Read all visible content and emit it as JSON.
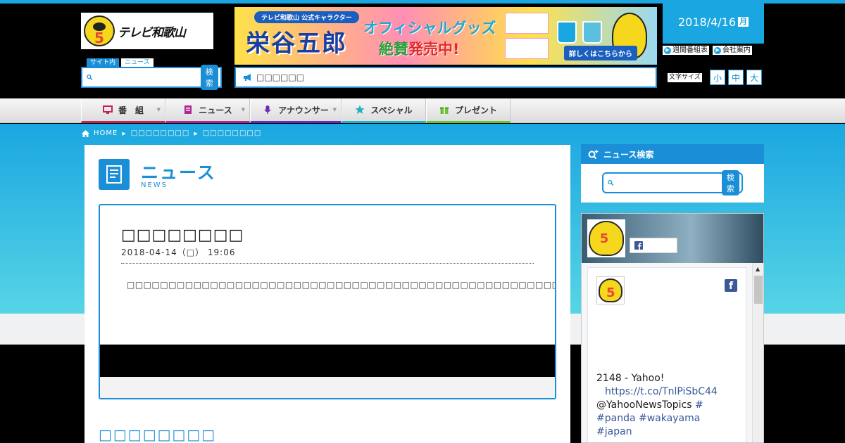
{
  "header": {
    "logo_text": "テレビ和歌山",
    "search_tabs": [
      "サイト内",
      "ニュース"
    ],
    "search_button": "検索",
    "search_placeholder": "",
    "ticker_text": "□□□□□□",
    "date": "2018/4/16",
    "day_of_week": "月",
    "mini_links": [
      "週間番組表",
      "会社案内"
    ],
    "font_size_label": "文字サイズ",
    "font_size_options": [
      "小",
      "中",
      "大"
    ]
  },
  "banner": {
    "top_label": "テレビ和歌山 公式キャラクター",
    "name": "栄谷五郎",
    "goods": "オフィシャルグッズ",
    "sale_part1": "絶賛",
    "sale_part2": "発売中!",
    "link": "詳しくはこちらから"
  },
  "nav": {
    "items": [
      {
        "label": "番　組",
        "icon": "tv-icon",
        "color": "#c7215d",
        "dropdown": true
      },
      {
        "label": "ニュース",
        "icon": "newspaper-icon",
        "color": "#b0278f",
        "dropdown": true
      },
      {
        "label": "アナウンサー",
        "icon": "microphone-icon",
        "color": "#6b2bb5",
        "dropdown": true
      },
      {
        "label": "スペシャル",
        "icon": "star-icon",
        "color": "#1fb3c4",
        "dropdown": false
      },
      {
        "label": "プレゼント",
        "icon": "gift-icon",
        "color": "#6fc13b",
        "dropdown": false
      }
    ]
  },
  "breadcrumb": {
    "home": "HOME",
    "items": [
      "□□□□□□□□",
      "□□□□□□□□"
    ]
  },
  "news_section": {
    "title": "ニュース",
    "subtitle": "NEWS"
  },
  "article": {
    "heading": "□□□□□□□□",
    "date": "2018-04-14（□） 19:06",
    "body": "□□□□□□□□□□□□□□□□□□□□□□□□□□□□□□□□□□□□□□□□□□□□□□□□□□□□□□□□□□□□□□□□□□□□□□□□□□□□□□□□□□□□□□□□□□□□□□□□□□□□□□□□□□□□□□□□□□□□□□□□□□□□□□□□□□□□□□□□□□□□□□□□□□□□□□□□□□□□□□□□□□□□□□□□□□□□□□□□□□□□□□□□□□□□□□□□□□□□□□□□□□□□□□□□□□□□□□□□□□□□□□□□□□□□□□□□□□□□□□□□□□□□□□□□□□□□□"
  },
  "related": {
    "title": "□□□□□□□□"
  },
  "sidebar": {
    "search_title": "ニュース検索",
    "search_button": "検索"
  },
  "facebook": {
    "feed_line1": "2148 - Yahoo!",
    "feed_link": "https://t.co/TnlPiSbC44",
    "feed_handle": "@YahooNewsTopics",
    "feed_hash1": "#",
    "feed_hash2": "#panda",
    "feed_hash3": "#wakayama",
    "feed_hash4": "#japan"
  },
  "colors": {
    "accent": "#1a8fd8",
    "sky": "#1aa6e0"
  }
}
